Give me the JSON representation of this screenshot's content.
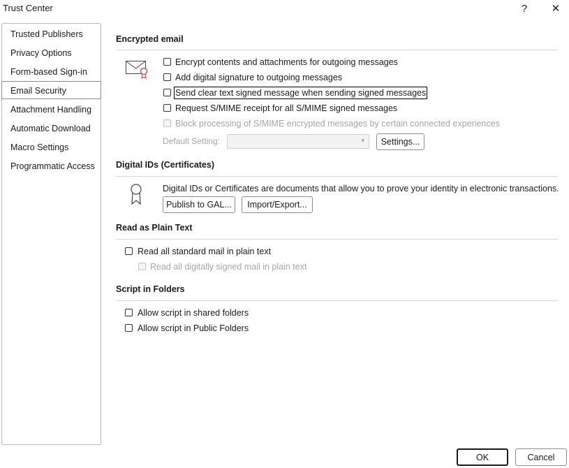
{
  "window": {
    "title": "Trust Center",
    "help_label": "?",
    "close_label": "✕"
  },
  "sidebar": {
    "items": [
      {
        "label": "Trusted Publishers"
      },
      {
        "label": "Privacy Options"
      },
      {
        "label": "Form-based Sign-in"
      },
      {
        "label": "Email Security",
        "selected": true
      },
      {
        "label": "Attachment Handling"
      },
      {
        "label": "Automatic Download"
      },
      {
        "label": "Macro Settings"
      },
      {
        "label": "Programmatic Access"
      }
    ]
  },
  "encrypted_email": {
    "title": "Encrypted email",
    "options": [
      {
        "label": "Encrypt contents and attachments for outgoing messages",
        "checked": false,
        "enabled": true
      },
      {
        "label": "Add digital signature to outgoing messages",
        "checked": false,
        "enabled": true
      },
      {
        "label": "Send clear text signed message when sending signed messages",
        "checked": false,
        "enabled": true,
        "focused": true
      },
      {
        "label": "Request S/MIME receipt for all S/MIME signed messages",
        "checked": false,
        "enabled": true
      },
      {
        "label": "Block processing of S/MIME encrypted messages by certain connected experiences",
        "checked": false,
        "enabled": false
      }
    ],
    "default_setting_label": "Default Setting:",
    "default_setting_value": "",
    "settings_button": "Settings..."
  },
  "digital_ids": {
    "title": "Digital IDs (Certificates)",
    "description": "Digital IDs or Certificates are documents that allow you to prove your identity in electronic transactions.",
    "publish_button": "Publish to GAL...",
    "import_export_button": "Import/Export..."
  },
  "plain_text": {
    "title": "Read as Plain Text",
    "options": [
      {
        "label": "Read all standard mail in plain text",
        "checked": false,
        "enabled": true
      },
      {
        "label": "Read all digitally signed mail in plain text",
        "checked": false,
        "enabled": false
      }
    ]
  },
  "script_folders": {
    "title": "Script in Folders",
    "options": [
      {
        "label": "Allow script in shared folders",
        "checked": false,
        "enabled": true
      },
      {
        "label": "Allow script in Public Folders",
        "checked": false,
        "enabled": true
      }
    ]
  },
  "footer": {
    "ok_label": "OK",
    "cancel_label": "Cancel"
  }
}
